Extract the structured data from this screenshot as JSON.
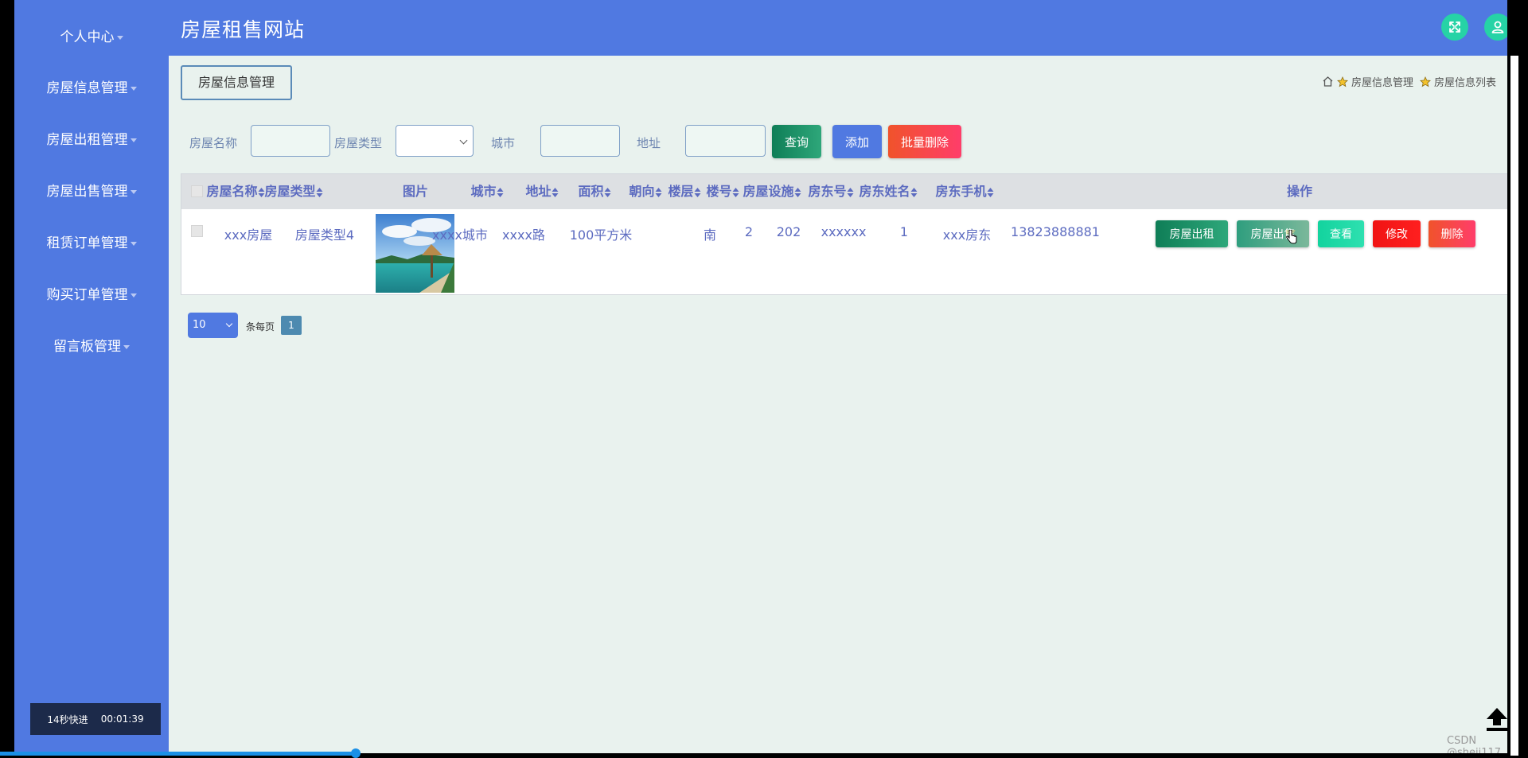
{
  "header": {
    "title": "房屋租售网站",
    "fullscreen_icon": "expand-icon",
    "user_icon": "user-icon"
  },
  "sidebar": {
    "items": [
      {
        "label": "个人中心"
      },
      {
        "label": "房屋信息管理"
      },
      {
        "label": "房屋出租管理"
      },
      {
        "label": "房屋出售管理"
      },
      {
        "label": "租赁订单管理"
      },
      {
        "label": "购买订单管理"
      },
      {
        "label": "留言板管理"
      }
    ]
  },
  "page_tag": "房屋信息管理",
  "breadcrumb": {
    "home_icon": "home-icon",
    "items": [
      "房屋信息管理",
      "房屋信息列表"
    ]
  },
  "search": {
    "name_label": "房屋名称",
    "type_label": "房屋类型",
    "city_label": "城市",
    "address_label": "地址",
    "query_button": "查询",
    "add_button": "添加",
    "batch_delete_button": "批量删除"
  },
  "table": {
    "columns": [
      "房屋名称",
      "房屋类型",
      "图片",
      "城市",
      "地址",
      "面积",
      "朝向",
      "楼层",
      "楼号",
      "房屋设施",
      "房东号",
      "房东姓名",
      "房东手机",
      "操作"
    ],
    "rows": [
      {
        "name": "xxx房屋",
        "type": "房屋类型4",
        "city": "xxxx城市",
        "address": "xxxx路",
        "area": "100平方米",
        "orientation": "南",
        "floor": "2",
        "building": "202",
        "facilities": "xxxxxx",
        "landlord_no": "1",
        "landlord_name": "xxx房东",
        "landlord_phone": "13823888881"
      }
    ],
    "actions": [
      "房屋出租",
      "房屋出售",
      "查看",
      "修改",
      "删除"
    ]
  },
  "pagination": {
    "page_size": "10",
    "per_page_label": "条每页",
    "current_page": "1"
  },
  "video_overlay": {
    "speed_text": "14秒快进",
    "time": "00:01:39",
    "progress": 0.233
  },
  "watermark": "CSDN @sheji117"
}
